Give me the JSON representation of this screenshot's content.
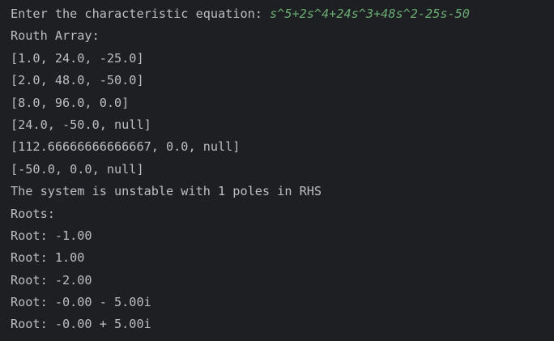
{
  "console": {
    "prompt": "Enter the characteristic equation: ",
    "input": "s^5+2s^4+24s^3+48s^2-25s-50",
    "lines": [
      "Routh Array:",
      "[1.0, 24.0, -25.0]",
      "[2.0, 48.0, -50.0]",
      "[8.0, 96.0, 0.0]",
      "[24.0, -50.0, null]",
      "[112.66666666666667, 0.0, null]",
      "[-50.0, 0.0, null]",
      "The system is unstable with 1 poles in RHS",
      "Roots:",
      "Root: -1.00",
      "Root: 1.00",
      "Root: -2.00",
      "Root: -0.00 - 5.00i",
      "Root: -0.00 + 5.00i"
    ]
  },
  "colors": {
    "background": "#1e1f22",
    "output_text": "#bcbec4",
    "user_input": "#6aab73"
  }
}
